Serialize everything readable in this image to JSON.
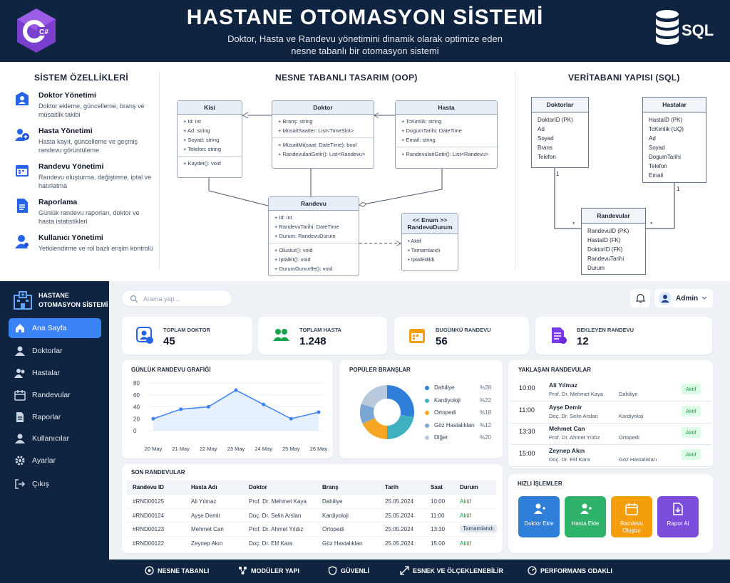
{
  "header": {
    "title": "HASTANE OTOMASYON SİSTEMİ",
    "subtitle_1": "Doktor, Hasta ve Randevu yönetimini dinamik olarak optimize eden",
    "subtitle_2": "nesne tabanlı bir otomasyon sistemi",
    "csharp": "C#",
    "sql": "SQL"
  },
  "features": {
    "heading": "SİSTEM ÖZELLİKLERİ",
    "items": [
      {
        "title": "Doktor Yönetimi",
        "desc": "Doktor ekleme, güncelleme, branş ve müsaitlik takibi",
        "icon": "doctor-icon"
      },
      {
        "title": "Hasta Yönetimi",
        "desc": "Hasta kayıt, güncelleme ve geçmiş randevu görüntüleme",
        "icon": "patients-icon"
      },
      {
        "title": "Randevu Yönetimi",
        "desc": "Randevu oluşturma, değiştirme, iptal ve hatırlatma",
        "icon": "calendar-icon"
      },
      {
        "title": "Raporlama",
        "desc": "Günlük randevu raporları, doktor ve hasta istatistikleri",
        "icon": "report-icon"
      },
      {
        "title": "Kullanıcı Yönetimi",
        "desc": "Yetkilendirme ve rol bazlı erişim kontrolü",
        "icon": "user-icon"
      }
    ]
  },
  "oop": {
    "heading": "NESNE TABANLI TASARIM (OOP)",
    "kisi": {
      "name": "Kisi",
      "attrs": [
        "+ Id: int",
        "+ Ad: string",
        "+ Soyad: string",
        "+ Telefon: string"
      ],
      "methods": [
        "+ Kaydet(): void"
      ]
    },
    "doktor": {
      "name": "Doktor",
      "attrs": [
        "+ Branş: string",
        "+ MüsaitSaatler: List<TimeSlot>"
      ],
      "methods": [
        "+ MüsaitMi(saat: DateTime): bool",
        "+ RandevulariGetir(): List<Randevu>"
      ]
    },
    "hasta": {
      "name": "Hasta",
      "attrs": [
        "+ TcKimlik: string",
        "+ DogumTarihi: DateTime",
        "+ Email: string"
      ],
      "methods": [
        "+ RandevulariGetir(): List<Randevu>"
      ]
    },
    "randevu": {
      "name": "Randevu",
      "attrs": [
        "+ Id: int",
        "+ RandevuTarihi: DateTime",
        "+ Durum: RandevuDurum"
      ],
      "methods": [
        "+ Olustur(): void",
        "+ IptalEt(): void",
        "+ DurumGuncelle(): void"
      ]
    },
    "enum": {
      "stereo": "<< Enum >>",
      "name": "RandevuDurum",
      "values": [
        "• Aktif",
        "• Tamamlandı",
        "• IptalEdildi"
      ]
    }
  },
  "sqldb": {
    "heading": "VERİTABANI YAPISI (SQL)",
    "doktorlar": {
      "name": "Doktorlar",
      "cols": [
        "DoktorID (PK)",
        "Ad",
        "Soyad",
        "Brans",
        "Telefon"
      ]
    },
    "hastalar": {
      "name": "Hastalar",
      "cols": [
        "HastaID (PK)",
        "TcKimlik (UQ)",
        "Ad",
        "Soyad",
        "DogumTarihi",
        "Telefon",
        "Email"
      ]
    },
    "randevular": {
      "name": "Randevular",
      "cols": [
        "RandevuID (PK)",
        "HastaID (FK)",
        "DoktorID (FK)",
        "RandevuTarihi",
        "Durum"
      ]
    },
    "one_a": "1",
    "one_b": "1",
    "many_a": "*",
    "many_b": "*"
  },
  "sidebar": {
    "brand_1": "HASTANE",
    "brand_2": "OTOMASYON SİSTEMİ",
    "items": [
      {
        "label": "Ana Sayfa",
        "icon": "home-icon"
      },
      {
        "label": "Doktorlar",
        "icon": "doctor-icon"
      },
      {
        "label": "Hastalar",
        "icon": "patients-icon"
      },
      {
        "label": "Randevular",
        "icon": "calendar-icon"
      },
      {
        "label": "Raporlar",
        "icon": "report-icon"
      },
      {
        "label": "Kullanıcılar",
        "icon": "users-icon"
      },
      {
        "label": "Ayarlar",
        "icon": "gear-icon"
      },
      {
        "label": "Çıkış",
        "icon": "logout-icon"
      }
    ]
  },
  "topbar": {
    "search_placeholder": "Arama yap...",
    "user": "Admin"
  },
  "stats": [
    {
      "label": "TOPLAM DOKTOR",
      "value": "45",
      "color": "#2563eb"
    },
    {
      "label": "TOPLAM HASTA",
      "value": "1.248",
      "color": "#16a34a"
    },
    {
      "label": "BUGÜNKÜ RANDEVU",
      "value": "56",
      "color": "#f59e0b"
    },
    {
      "label": "BEKLEYEN RANDEVU",
      "value": "12",
      "color": "#7c3aed"
    }
  ],
  "chart_data": [
    {
      "type": "area",
      "title": "GÜNLÜK RANDEVU GRAFİĞİ",
      "x": [
        "20 May",
        "21 May",
        "22 May",
        "23 May",
        "24 May",
        "25 May",
        "26 May"
      ],
      "values": [
        20,
        36,
        40,
        68,
        44,
        20,
        31
      ],
      "ylim": [
        0,
        80
      ],
      "yticks": [
        "0",
        "20",
        "40",
        "60",
        "80"
      ],
      "color": "#3b82f6"
    },
    {
      "type": "pie",
      "title": "POPÜLER BRANŞLAR",
      "labels": [
        "Dahiliye",
        "Kardiyoloji",
        "Ortopedi",
        "Göz Hastalıkları",
        "Diğer"
      ],
      "values": [
        28,
        22,
        18,
        12,
        20
      ],
      "value_labels": [
        "%28",
        "%22",
        "%18",
        "%12",
        "%20"
      ],
      "colors": [
        "#2f7ed8",
        "#3fb0c0",
        "#f5a623",
        "#7aa6d6",
        "#b8c9dc"
      ]
    }
  ],
  "upcoming": {
    "title": "YAKLAŞAN RANDEVULAR",
    "items": [
      {
        "time": "10:00",
        "name": "Ali Yılmaz",
        "doctor": "Prof. Dr. Mehmet Kaya",
        "branch": "Dahiliye",
        "status": "Aktif"
      },
      {
        "time": "11:00",
        "name": "Ayşe Demir",
        "doctor": "Doç. Dr. Selin Arslan",
        "branch": "Kardiyoloji",
        "status": "Aktif"
      },
      {
        "time": "13:30",
        "name": "Mehmet Can",
        "doctor": "Prof. Dr. Ahmet Yıldız",
        "branch": "Ortopedi",
        "status": "Aktif"
      },
      {
        "time": "15:00",
        "name": "Zeynep Akın",
        "doctor": "Doç. Dr. Elif Kara",
        "branch": "Göz Hastalıkları",
        "status": "Aktif"
      }
    ]
  },
  "recent": {
    "title": "SON RANDEVULAR",
    "headers": [
      "Randevu ID",
      "Hasta Adı",
      "Doktor",
      "Branş",
      "Tarih",
      "Saat",
      "Durum"
    ],
    "rows": [
      [
        "#RND00125",
        "Ali Yılmaz",
        "Prof. Dr. Mehmet Kaya",
        "Dahiliye",
        "25.05.2024",
        "10:00",
        "Aktif"
      ],
      [
        "#RND00124",
        "Ayşe Demir",
        "Doç. Dr. Selin Arslan",
        "Kardiyoloji",
        "25.05.2024",
        "11:00",
        "Aktif"
      ],
      [
        "#RND00123",
        "Mehmet Can",
        "Prof. Dr. Ahmet Yıldız",
        "Ortopedi",
        "25.05.2024",
        "13:30",
        "Tamamlandı"
      ],
      [
        "#RND00122",
        "Zeynep Akın",
        "Doç. Dr. Elif Kara",
        "Göz Hastalıkları",
        "25.05.2024",
        "15:00",
        "Aktif"
      ]
    ]
  },
  "quick": {
    "title": "HIZLI İŞLEMLER",
    "items": [
      {
        "label": "Doktor Ekle",
        "color": "#2f7ed8"
      },
      {
        "label": "Hasta Ekle",
        "color": "#2fb36b"
      },
      {
        "label": "Randevu Oluştur",
        "color": "#f59e0b"
      },
      {
        "label": "Rapor Al",
        "color": "#7c4ddb"
      }
    ]
  },
  "footer": [
    {
      "label": "NESNE TABANLI"
    },
    {
      "label": "MODÜLER YAPI"
    },
    {
      "label": "GÜVENLİ"
    },
    {
      "label": "ESNEK VE ÖLÇEKLENEBİLİR"
    },
    {
      "label": "PERFORMANS ODAKLI"
    }
  ]
}
